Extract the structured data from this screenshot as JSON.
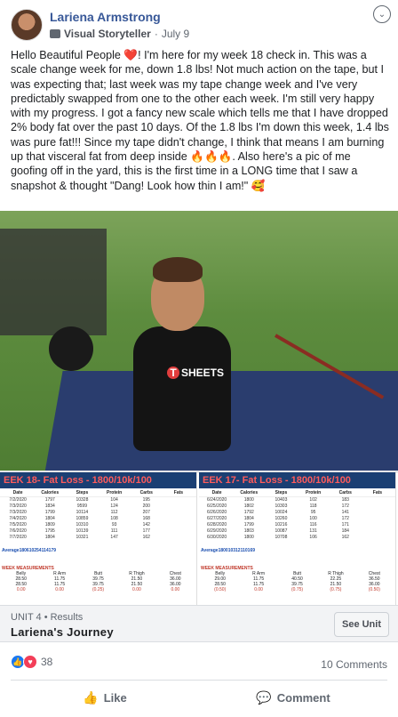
{
  "post": {
    "author": "Lariena Armstrong",
    "role": "Visual Storyteller",
    "separator": "·",
    "date": "July 9",
    "more_icon": "⌄",
    "text": "Hello Beautiful People ❤️! I'm here for my week 18 check in. This was a scale change week for me, down 1.8 lbs! Not much action on the tape, but I was expecting that; last week was my tape change week and I've very predictably swapped from one to the other each week. I'm still very happy with my progress. I got a fancy new scale which tells me that I have dropped 2% body fat over the past 10 days. Of the 1.8 lbs I'm down this week, 1.4 lbs was pure fat!!! Since my tape didn't change, I think that means I am burning up that visceral fat from deep inside 🔥🔥🔥. Also here's a pic of me goofing off in the yard, this is the first time in a LONG time that I saw a snapshot & thought \"Dang! Look how thin I am!\" 🥰"
  },
  "photo": {
    "shirt_logo_letter": "T",
    "shirt_logo_text": "SHEETS"
  },
  "sheets": {
    "left": {
      "title": "EEK 18- Fat Loss - 1800/10k/100",
      "columns": [
        "Date",
        "Calories",
        "Steps",
        "Protein",
        "Carbs",
        "Fats"
      ],
      "rows": [
        [
          "7/2/2020",
          "1797",
          "10328",
          "104",
          "195",
          ""
        ],
        [
          "7/3/2020",
          "1834",
          "9599",
          "124",
          "200",
          ""
        ],
        [
          "7/3/2020",
          "1799",
          "10114",
          "112",
          "207",
          ""
        ],
        [
          "7/4/2020",
          "1804",
          "10859",
          "108",
          "168",
          ""
        ],
        [
          "7/5/2020",
          "1809",
          "10310",
          "93",
          "142",
          ""
        ],
        [
          "7/6/2020",
          "1795",
          "10139",
          "111",
          "177",
          ""
        ],
        [
          "7/7/2020",
          "1804",
          "10321",
          "147",
          "162",
          ""
        ]
      ],
      "average_label": "Average",
      "average": [
        "1806",
        "10254",
        "114",
        "179"
      ],
      "measurements_label": "WEEK MEASUREMENTS",
      "meas_columns": [
        "Belly",
        "R Arm",
        "Butt",
        "R Thigh",
        "Chest"
      ],
      "meas_rows": [
        [
          "28.50",
          "11.75",
          "39.75",
          "21.50",
          "36.00"
        ],
        [
          "28.50",
          "11.75",
          "39.75",
          "21.50",
          "36.00"
        ],
        [
          "0.00",
          "0.00",
          "(0.25)",
          "0.00",
          "0.00"
        ]
      ]
    },
    "right": {
      "title": "EEK 17- Fat Loss - 1800/10k/100",
      "columns": [
        "Date",
        "Calories",
        "Steps",
        "Protein",
        "Carbs",
        "Fats"
      ],
      "rows": [
        [
          "6/24/2020",
          "1800",
          "10403",
          "102",
          "183",
          ""
        ],
        [
          "6/25/2020",
          "1802",
          "10303",
          "118",
          "172",
          ""
        ],
        [
          "6/26/2020",
          "1792",
          "10024",
          "95",
          "141",
          ""
        ],
        [
          "6/27/2020",
          "1804",
          "10260",
          "100",
          "172",
          ""
        ],
        [
          "6/28/2020",
          "1799",
          "10216",
          "116",
          "171",
          ""
        ],
        [
          "6/29/2020",
          "1803",
          "10087",
          "131",
          "184",
          ""
        ],
        [
          "6/30/2020",
          "1800",
          "10708",
          "106",
          "162",
          ""
        ]
      ],
      "average_label": "Average",
      "average": [
        "1800",
        "10312",
        "110",
        "169"
      ],
      "measurements_label": "WEEK MEASUREMENTS",
      "meas_columns": [
        "Belly",
        "R Arm",
        "Butt",
        "R Thigh",
        "Chest"
      ],
      "meas_rows": [
        [
          "29.00",
          "11.75",
          "40.50",
          "22.25",
          "36.50"
        ],
        [
          "28.50",
          "11.75",
          "39.75",
          "21.50",
          "36.00"
        ],
        [
          "(0.50)",
          "0.00",
          "(0.75)",
          "(0.75)",
          "(0.50)"
        ]
      ]
    }
  },
  "unit": {
    "label": "UNIT 4 • Results",
    "title": "Lariena's Journey",
    "button": "See Unit"
  },
  "reactions": {
    "like_icon": "👍",
    "love_icon": "♥",
    "count": "38",
    "comments": "10 Comments"
  },
  "actions": {
    "like": "Like",
    "comment": "Comment",
    "like_icon": "👍",
    "comment_icon": "💬"
  }
}
